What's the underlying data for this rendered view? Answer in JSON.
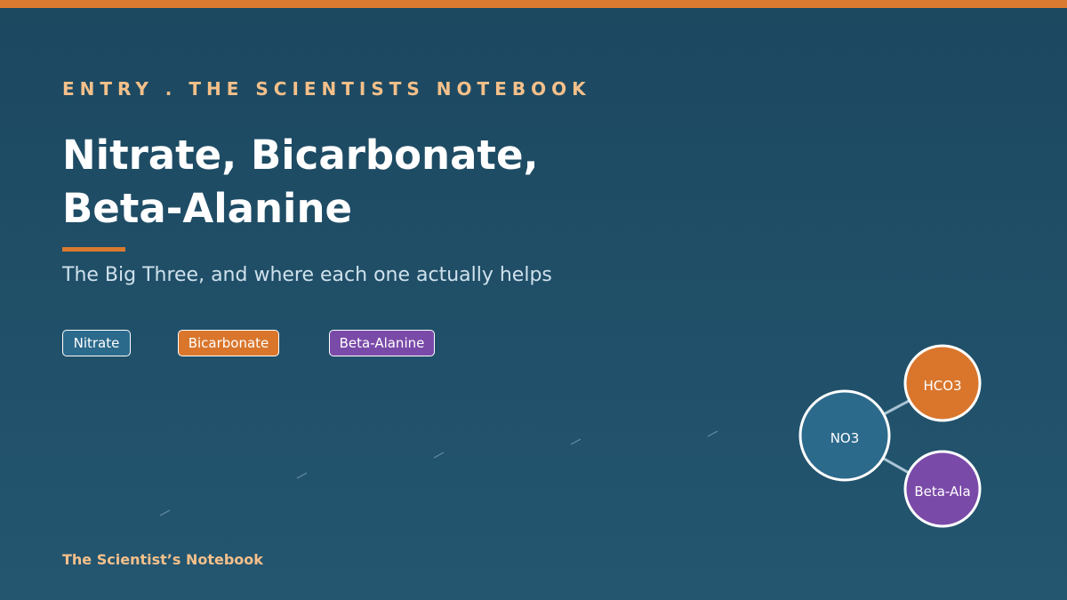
{
  "header": {
    "kicker": "ENTRY . THE SCIENTISTS NOTEBOOK",
    "title_line1": "Nitrate, Bicarbonate,",
    "title_line2": "Beta-Alanine",
    "subtitle": "The Big Three, and where each one actually helps"
  },
  "tags": [
    {
      "label": "Nitrate",
      "color": "#2c6a8c"
    },
    {
      "label": "Bicarbonate",
      "color": "#d9762c"
    },
    {
      "label": "Beta-Alanine",
      "color": "#7a4aa8"
    }
  ],
  "diagram": {
    "nodes": [
      {
        "label": "NO3",
        "color": "#2c6a8c"
      },
      {
        "label": "HCO3",
        "color": "#d9762c"
      },
      {
        "label": "Beta-Ala",
        "color": "#7a4aa8"
      }
    ]
  },
  "footer": {
    "brand": "The Scientist’s Notebook"
  },
  "colors": {
    "accent": "#d97a30",
    "kicker": "#f5c08a",
    "background_top": "#1c4860",
    "background_bottom": "#245670"
  }
}
